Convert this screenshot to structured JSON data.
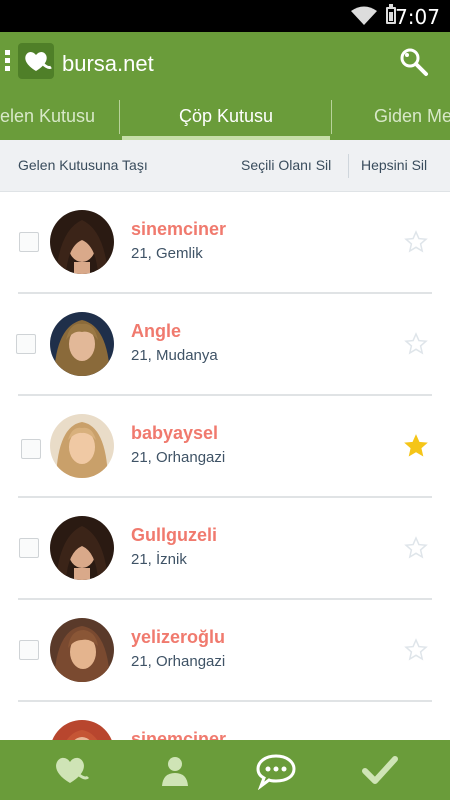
{
  "status_bar": {
    "time": "7:07"
  },
  "app": {
    "title": "bursa.net"
  },
  "tabs": [
    {
      "label": "Gelen Kutusu"
    },
    {
      "label": "Çöp Kutusu"
    },
    {
      "label": "Giden Mesajlar"
    }
  ],
  "actions": {
    "move_to_inbox": "Gelen Kutusuna Taşı",
    "delete_selected": "Seçili Olanı Sil",
    "delete_all": "Hepsini Sil"
  },
  "messages": [
    {
      "name": "sinemciner",
      "detail": "21, Gemlik",
      "starred": false
    },
    {
      "name": "Angle",
      "detail": "21, Mudanya",
      "starred": false
    },
    {
      "name": "babyaysel",
      "detail": "21, Orhangazi",
      "starred": true
    },
    {
      "name": "Gullguzeli",
      "detail": "21, İznik",
      "starred": false
    },
    {
      "name": "yelizeroğlu",
      "detail": "21, Orhangazi",
      "starred": false
    },
    {
      "name": "sinemciner",
      "detail": "",
      "starred": false
    }
  ],
  "colors": {
    "primary": "#6a9c3a",
    "name_text": "#f07a6e",
    "star_active": "#f5c518",
    "star_inactive": "#dfe5ea"
  },
  "bottom_nav": [
    {
      "icon": "heart-icon"
    },
    {
      "icon": "profile-icon"
    },
    {
      "icon": "chat-bubble-icon"
    },
    {
      "icon": "checkmark-icon"
    }
  ]
}
